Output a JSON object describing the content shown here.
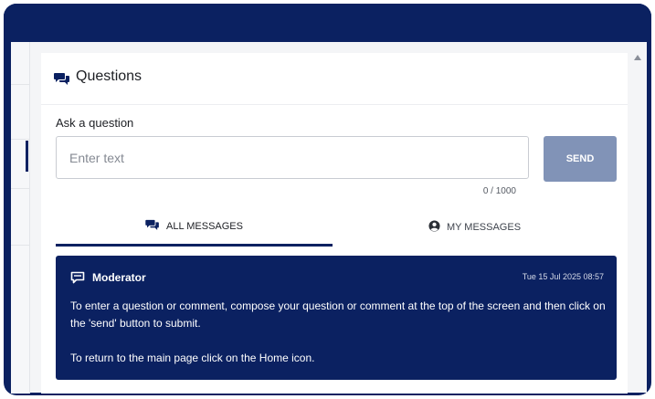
{
  "panel": {
    "title": "Questions",
    "title_icon": "chat-bubbles-icon"
  },
  "form": {
    "label": "Ask a question",
    "input_placeholder": "Enter text",
    "input_value": "",
    "send_label": "SEND",
    "char_count": "0 / 1000"
  },
  "tabs": [
    {
      "label": "ALL MESSAGES",
      "icon": "chat-bubbles-icon",
      "active": true
    },
    {
      "label": "MY MESSAGES",
      "icon": "user-circle-icon",
      "active": false
    }
  ],
  "messages": [
    {
      "author": "Moderator",
      "author_icon": "moderator-chat-icon",
      "timestamp": "Tue 15 Jul 2025 08:57",
      "body_line1": "To enter a question or comment, compose your question or comment at the top of the screen and then click on the 'send' button to submit.",
      "body_line2": "To return to the main page click on the Home icon."
    }
  ],
  "colors": {
    "brand_navy": "#0b2161",
    "send_button": "#8193b7",
    "background": "#f4f5f7"
  }
}
